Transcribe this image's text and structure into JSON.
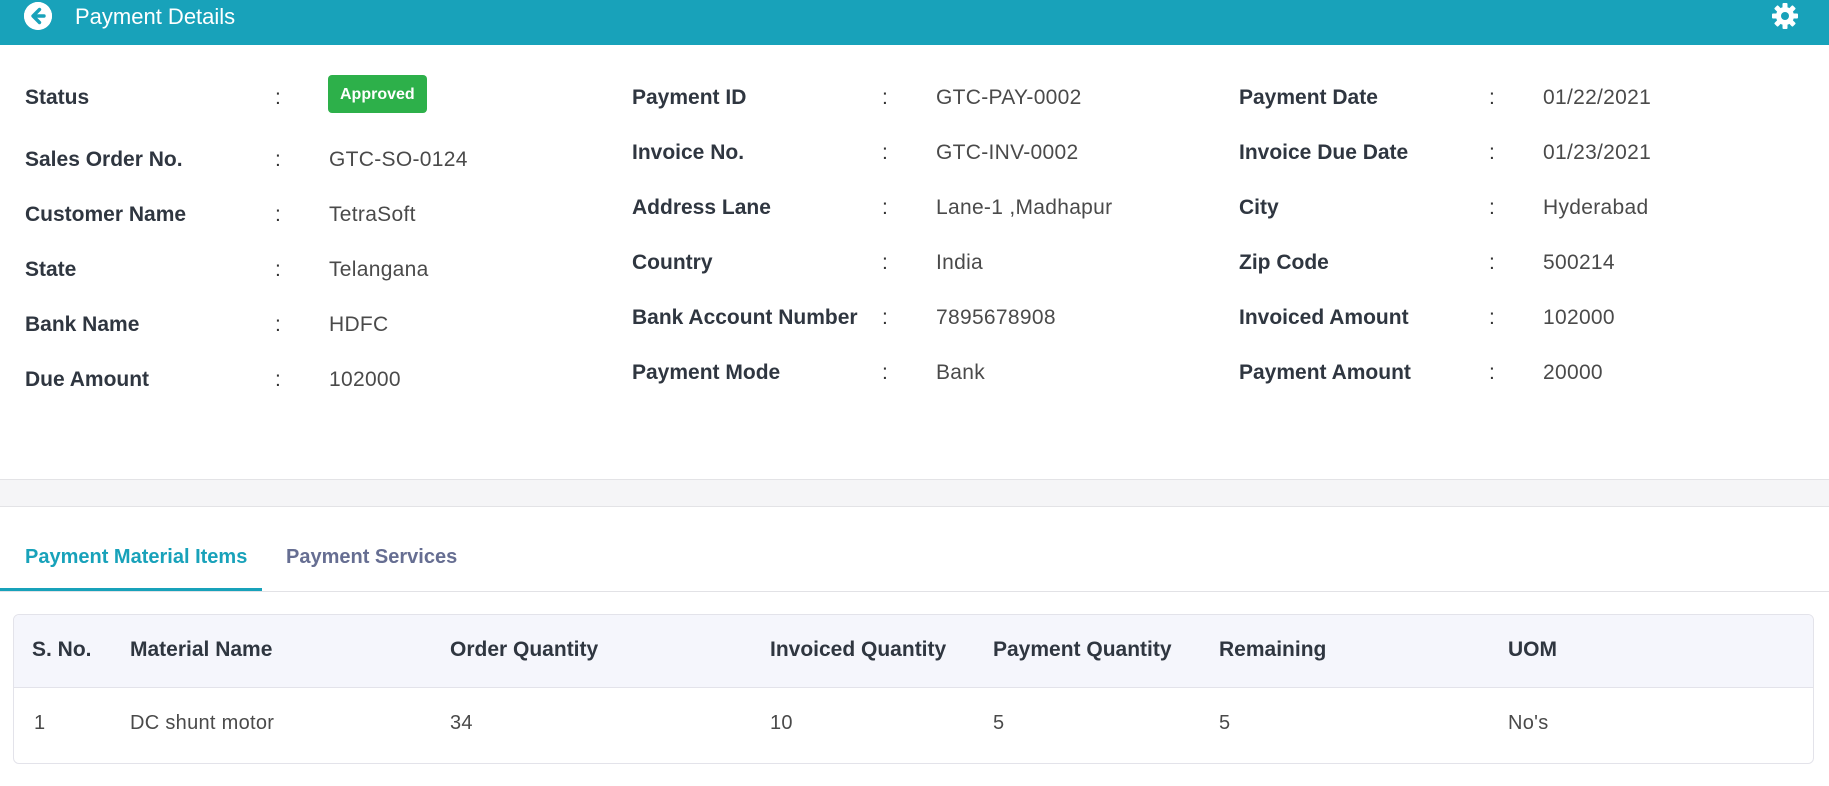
{
  "header": {
    "title": "Payment Details",
    "back_icon": "arrow-left-circle-icon",
    "settings_icon": "gear-icon",
    "bar_color": "#18a2ba"
  },
  "details": {
    "col1": [
      {
        "label": "Status",
        "value": "Approved",
        "badge": true
      },
      {
        "label": "Sales Order No.",
        "value": "GTC-SO-0124"
      },
      {
        "label": "Customer Name",
        "value": "TetraSoft"
      },
      {
        "label": "State",
        "value": "Telangana"
      },
      {
        "label": "Bank Name",
        "value": "HDFC"
      },
      {
        "label": "Due Amount",
        "value": "102000"
      }
    ],
    "col2": [
      {
        "label": "Payment ID",
        "value": "GTC-PAY-0002"
      },
      {
        "label": "Invoice No.",
        "value": "GTC-INV-0002"
      },
      {
        "label": "Address Lane",
        "value": "Lane-1 ,Madhapur"
      },
      {
        "label": "Country",
        "value": "India"
      },
      {
        "label": "Bank Account Number",
        "value": "7895678908"
      },
      {
        "label": "Payment Mode",
        "value": "Bank"
      }
    ],
    "col3": [
      {
        "label": "Payment Date",
        "value": "01/22/2021"
      },
      {
        "label": "Invoice Due Date",
        "value": "01/23/2021"
      },
      {
        "label": "City",
        "value": "Hyderabad"
      },
      {
        "label": "Zip Code",
        "value": "500214"
      },
      {
        "label": "Invoiced Amount",
        "value": "102000"
      },
      {
        "label": "Payment Amount",
        "value": "20000"
      }
    ],
    "separator": ":",
    "status_color": "#2db04a"
  },
  "tabs": [
    {
      "label": "Payment Material Items",
      "active": true
    },
    {
      "label": "Payment Services",
      "active": false
    }
  ],
  "table": {
    "columns": [
      "S. No.",
      "Material Name",
      "Order Quantity",
      "Invoiced Quantity",
      "Payment Quantity",
      "Remaining",
      "UOM"
    ],
    "rows": [
      [
        "1",
        "DC shunt motor",
        "34",
        "10",
        "5",
        "5",
        "No's"
      ]
    ]
  }
}
